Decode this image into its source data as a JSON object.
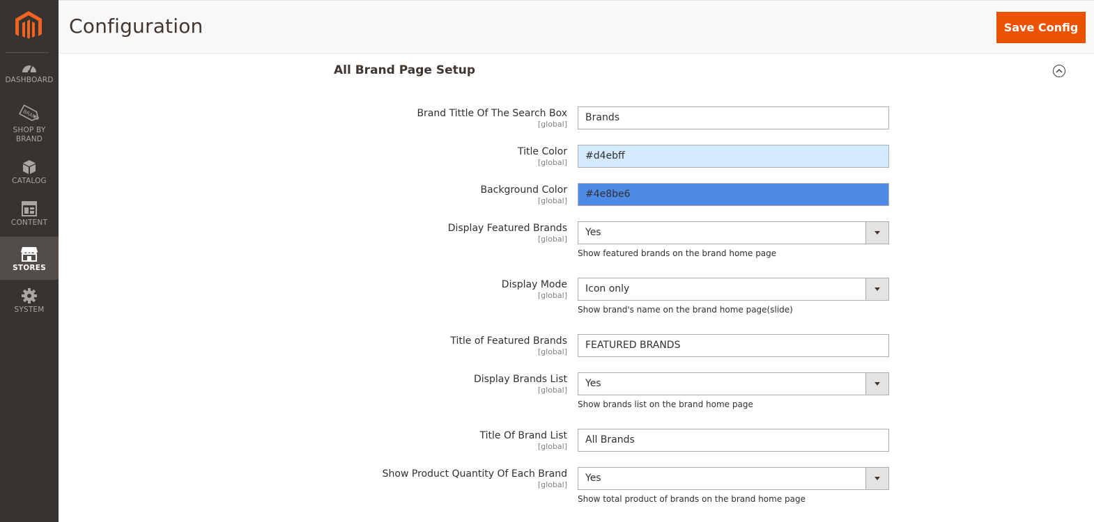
{
  "sidebar": {
    "items": [
      {
        "label": "DASHBOARD",
        "icon": "dashboard-icon"
      },
      {
        "label": "SHOP BY BRAND",
        "icon": "brand-tag-icon"
      },
      {
        "label": "CATALOG",
        "icon": "catalog-box-icon"
      },
      {
        "label": "CONTENT",
        "icon": "content-layout-icon"
      },
      {
        "label": "STORES",
        "icon": "stores-icon",
        "active": true
      },
      {
        "label": "SYSTEM",
        "icon": "gear-icon"
      }
    ]
  },
  "header": {
    "title": "Configuration",
    "save_label": "Save Config"
  },
  "section": {
    "title": "All Brand Page Setup",
    "scope_text": "[global]"
  },
  "fields": {
    "search_box_title": {
      "label": "Brand Tittle Of The Search Box",
      "value": "Brands"
    },
    "title_color": {
      "label": "Title Color",
      "value": "#d4ebff"
    },
    "background_color": {
      "label": "Background Color",
      "value": "#4e8be6"
    },
    "display_featured": {
      "label": "Display Featured Brands",
      "value": "Yes",
      "note": "Show featured brands on the brand home page"
    },
    "display_mode": {
      "label": "Display Mode",
      "value": "Icon only",
      "note": "Show brand's name on the brand home page(slide)"
    },
    "featured_title": {
      "label": "Title of Featured Brands",
      "value": "FEATURED BRANDS"
    },
    "display_list": {
      "label": "Display Brands List",
      "value": "Yes",
      "note": "Show brands list on the brand home page"
    },
    "list_title": {
      "label": "Title Of Brand List",
      "value": "All Brands"
    },
    "show_quantity": {
      "label": "Show Product Quantity Of Each Brand",
      "value": "Yes",
      "note": "Show total product of brands on the brand home page"
    }
  },
  "colors": {
    "accent": "#eb5202",
    "sidebar_bg": "#373330",
    "title_color_swatch": "#d4ebff",
    "background_color_swatch": "#4e8be6"
  }
}
